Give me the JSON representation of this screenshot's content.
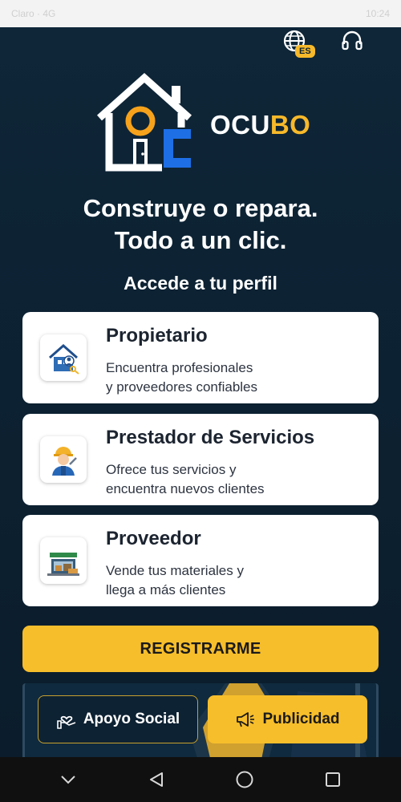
{
  "status_bar": {
    "left": "Claro · 4G",
    "right": "10:24"
  },
  "header": {
    "language_badge": "ES",
    "language_icon": "globe-icon",
    "support_icon": "headset-icon"
  },
  "brand": {
    "name_part1": "OCU",
    "name_part2": "BO",
    "accent": "#f7b92a",
    "logo_blue": "#1e6fe6"
  },
  "hero": {
    "line1": "Construye o repara.",
    "line2": "Todo a un clic."
  },
  "profile_section": {
    "title": "Accede a tu perfil"
  },
  "profiles": [
    {
      "title": "Propietario",
      "desc1": "Encuentra profesionales",
      "desc2": "y proveedores confiables",
      "icon": "house-key-icon"
    },
    {
      "title": "Prestador de Servicios",
      "desc1": "Ofrece tus servicios y",
      "desc2": "encuentra nuevos clientes",
      "icon": "worker-icon"
    },
    {
      "title": "Proveedor",
      "desc1": "Vende tus materiales y",
      "desc2": "llega a más clientes",
      "icon": "store-icon"
    }
  ],
  "register": {
    "label": "REGISTRARME"
  },
  "promo": {
    "apoyo_label": "Apoyo Social",
    "apoyo_icon": "heart-hand-icon",
    "publicidad_label": "Publicidad",
    "publicidad_icon": "megaphone-icon"
  },
  "navigation": {
    "icons": [
      "chevron-down-icon",
      "back-icon",
      "home-icon",
      "recents-icon"
    ]
  }
}
